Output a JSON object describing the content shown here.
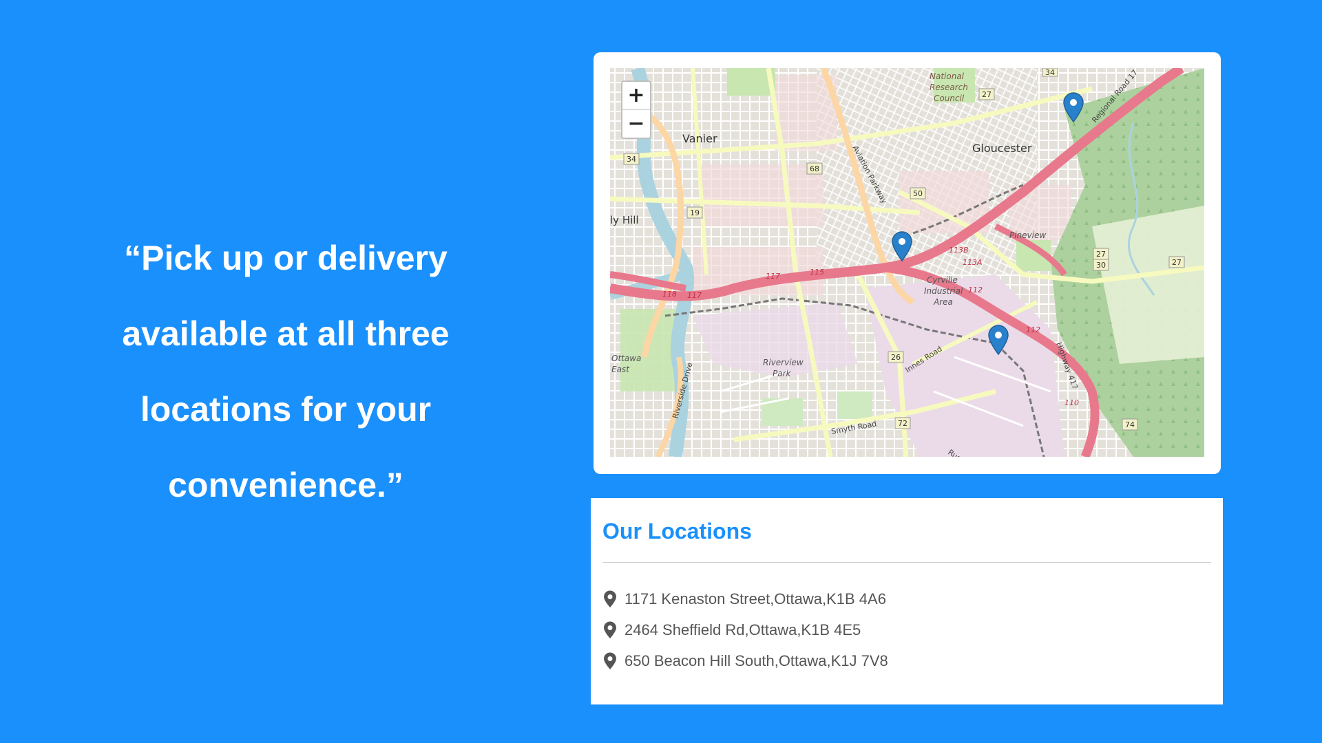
{
  "quote": {
    "line1": "“Pick up or delivery",
    "line2": "available at all three",
    "line3": "locations for your",
    "line4": "convenience.”"
  },
  "map": {
    "zoom_in": "+",
    "zoom_out": "−",
    "labels": {
      "vanier": "Vanier",
      "gloucester": "Gloucester",
      "pineview": "Pineview",
      "ly_hill": "ly Hill",
      "nrc1": "National",
      "nrc2": "Research",
      "nrc3": "Council",
      "cyrville1": "Cyrville",
      "cyrville2": "Industrial",
      "cyrville3": "Area",
      "riverview1": "Riverview",
      "riverview2": "Park",
      "ottawa_east1": "Ottawa",
      "ottawa_east2": "East",
      "aviation": "Aviation Parkway",
      "innes": "Innes Road",
      "smyth": "Smyth Road",
      "riverside": "Riverside Drive",
      "highway417": "Highway 417",
      "regional": "Regional Road 17",
      "rus": "Rus"
    },
    "shields": {
      "s34a": "34",
      "s34b": "34",
      "s27a": "27",
      "s68": "68",
      "s19": "19",
      "s50": "50",
      "s27b": "27",
      "s30": "30",
      "s27c": "27",
      "s26": "26",
      "s72": "72",
      "s74": "74"
    },
    "exits": {
      "e113b": "113B",
      "e113a": "113A",
      "e112a": "112",
      "e112b": "112",
      "e117a": "117",
      "e115": "115",
      "e118": "118",
      "e117b": "117",
      "e110": "110"
    },
    "colors": {
      "highway": "#e8798c",
      "pin": "#2a81cb"
    }
  },
  "locations": {
    "title": "Our Locations",
    "items": [
      "1171 Kenaston Street,Ottawa,K1B 4A6",
      "2464 Sheffield Rd,Ottawa,K1B 4E5",
      "650 Beacon Hill South,Ottawa,K1J 7V8"
    ]
  }
}
